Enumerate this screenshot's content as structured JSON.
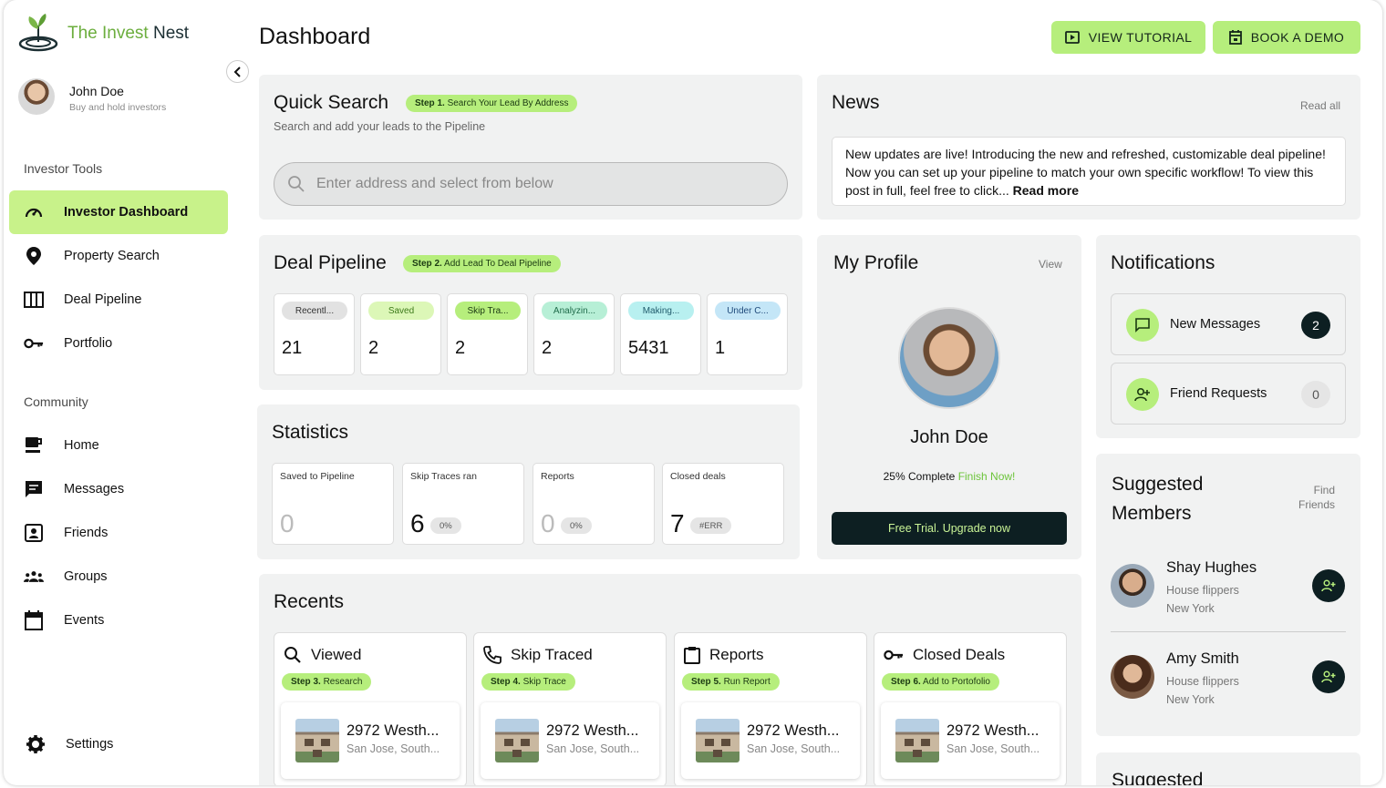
{
  "brand": {
    "name_part1": "The Invest",
    "name_part2": "Nest"
  },
  "user": {
    "name": "John Doe",
    "subtitle": "Buy and hold investors"
  },
  "sidebar": {
    "section_tools": "Investor Tools",
    "tools": [
      {
        "label": "Investor Dashboard",
        "icon": "speedometer-icon",
        "active": true
      },
      {
        "label": "Property Search",
        "icon": "location-pin-icon"
      },
      {
        "label": "Deal Pipeline",
        "icon": "columns-icon"
      },
      {
        "label": "Portfolio",
        "icon": "key-icon"
      }
    ],
    "section_community": "Community",
    "community": [
      {
        "label": "Home",
        "icon": "coffee-cup-icon"
      },
      {
        "label": "Messages",
        "icon": "message-icon"
      },
      {
        "label": "Friends",
        "icon": "contact-card-icon"
      },
      {
        "label": "Groups",
        "icon": "groups-icon"
      },
      {
        "label": "Events",
        "icon": "calendar-icon"
      }
    ],
    "settings": "Settings"
  },
  "header": {
    "title": "Dashboard",
    "tutorial_button": "VIEW TUTORIAL",
    "demo_button": "BOOK A DEMO"
  },
  "quick_search": {
    "title": "Quick Search",
    "step_bold": "Step 1.",
    "step_text": "Search Your Lead By Address",
    "subtitle": "Search and add your leads to the Pipeline",
    "placeholder": "Enter address and select from below"
  },
  "news": {
    "title": "News",
    "read_all": "Read all",
    "body": "New updates are live! Introducing the new and refreshed, customizable deal pipeline! Now you can set up your pipeline to match your own specific workflow! To view this post in full, feel free to click...",
    "read_more": "Read more"
  },
  "deal_pipeline": {
    "title": "Deal Pipeline",
    "step_bold": "Step 2.",
    "step_text": "Add Lead To Deal Pipeline",
    "stages": [
      {
        "label": "Recentl...",
        "count": "21",
        "color": "#e2e2e2"
      },
      {
        "label": "Saved",
        "count": "2",
        "color": "#dcf7b7"
      },
      {
        "label": "Skip Tra...",
        "count": "2",
        "color": "#b6ee7c"
      },
      {
        "label": "Analyzin...",
        "count": "2",
        "color": "#b7efd6"
      },
      {
        "label": "Making...",
        "count": "5431",
        "color": "#b8f0f0"
      },
      {
        "label": "Under C...",
        "count": "1",
        "color": "#c4e6f7"
      }
    ]
  },
  "statistics": {
    "title": "Statistics",
    "items": [
      {
        "label": "Saved to Pipeline",
        "value": "0",
        "pct": ""
      },
      {
        "label": "Skip Traces ran",
        "value": "6",
        "pct": "0%"
      },
      {
        "label": "Reports",
        "value": "0",
        "pct": "0%"
      },
      {
        "label": "Closed deals",
        "value": "7",
        "pct": "#ERR"
      }
    ]
  },
  "profile": {
    "title": "My Profile",
    "view": "View",
    "name": "John Doe",
    "complete": "25% Complete",
    "finish": "Finish Now!",
    "upgrade": "Free Trial. Upgrade now"
  },
  "notifications": {
    "title": "Notifications",
    "items": [
      {
        "label": "New Messages",
        "count": "2",
        "icon": "message-icon"
      },
      {
        "label": "Friend Requests",
        "count": "0",
        "icon": "add-user-icon"
      }
    ]
  },
  "suggested": {
    "title_line1": "Suggested",
    "title_line2": "Members",
    "find_line1": "Find",
    "find_line2": "Friends",
    "members": [
      {
        "name": "Shay Hughes",
        "role": "House flippers",
        "city": "New York"
      },
      {
        "name": "Amy Smith",
        "role": "House flippers",
        "city": "New York"
      }
    ],
    "next_title": "Suggested"
  },
  "recents": {
    "title": "Recents",
    "columns": [
      {
        "label": "Viewed",
        "step_bold": "Step 3.",
        "step_text": "Research",
        "icon": "search-icon",
        "address": "2972 Westh...",
        "city": "San Jose, South..."
      },
      {
        "label": "Skip Traced",
        "step_bold": "Step 4.",
        "step_text": "Skip Trace",
        "icon": "phone-icon",
        "address": "2972 Westh...",
        "city": "San Jose, South..."
      },
      {
        "label": "Reports",
        "step_bold": "Step 5.",
        "step_text": "Run Report",
        "icon": "clipboard-icon",
        "address": "2972 Westh...",
        "city": "San Jose, South..."
      },
      {
        "label": "Closed Deals",
        "step_bold": "Step 6.",
        "step_text": "Add to Portofolio",
        "icon": "key-icon",
        "address": "2972 Westh...",
        "city": "San Jose, South..."
      }
    ]
  }
}
